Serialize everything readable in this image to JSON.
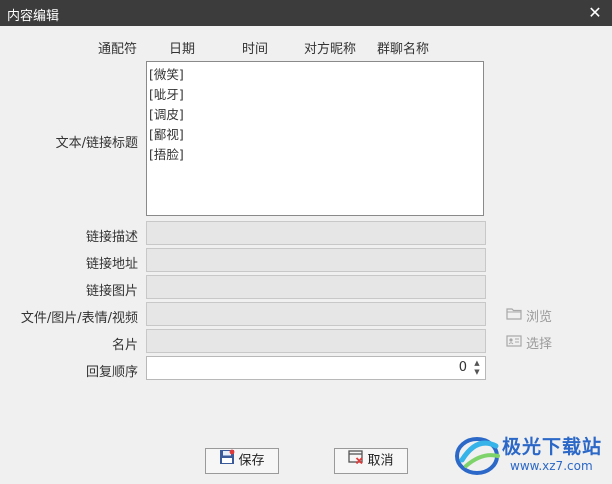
{
  "window": {
    "title": "内容编辑"
  },
  "wildcards": {
    "label": "通配符",
    "items": [
      "日期",
      "时间",
      "对方昵称",
      "群聊名称"
    ]
  },
  "fields": {
    "text_link_title": {
      "label": "文本/链接标题",
      "lines": [
        "[微笑]",
        "[呲牙]",
        "[调皮]",
        "[鄙视]",
        "[捂脸]"
      ]
    },
    "link_desc": {
      "label": "链接描述",
      "value": ""
    },
    "link_url": {
      "label": "链接地址",
      "value": ""
    },
    "link_image": {
      "label": "链接图片",
      "value": ""
    },
    "file": {
      "label": "文件/图片/表情/视频",
      "value": ""
    },
    "card": {
      "label": "名片",
      "value": ""
    },
    "reply_order": {
      "label": "回复顺序",
      "value": "0"
    }
  },
  "side_buttons": {
    "browse": "浏览",
    "select": "选择"
  },
  "buttons": {
    "save": "保存",
    "cancel": "取消"
  },
  "watermark": {
    "title": "极光下载站",
    "url": "www.xz7.com"
  },
  "icons": {
    "close": "close-icon",
    "folder": "folder-icon",
    "card": "card-icon",
    "save": "save-icon",
    "cancel": "cancel-icon",
    "logo": "aurora-logo-icon"
  },
  "colors": {
    "titlebar": "#3c3c3c",
    "background": "#f0f0f0",
    "watermark_blue": "#2b68c7"
  }
}
